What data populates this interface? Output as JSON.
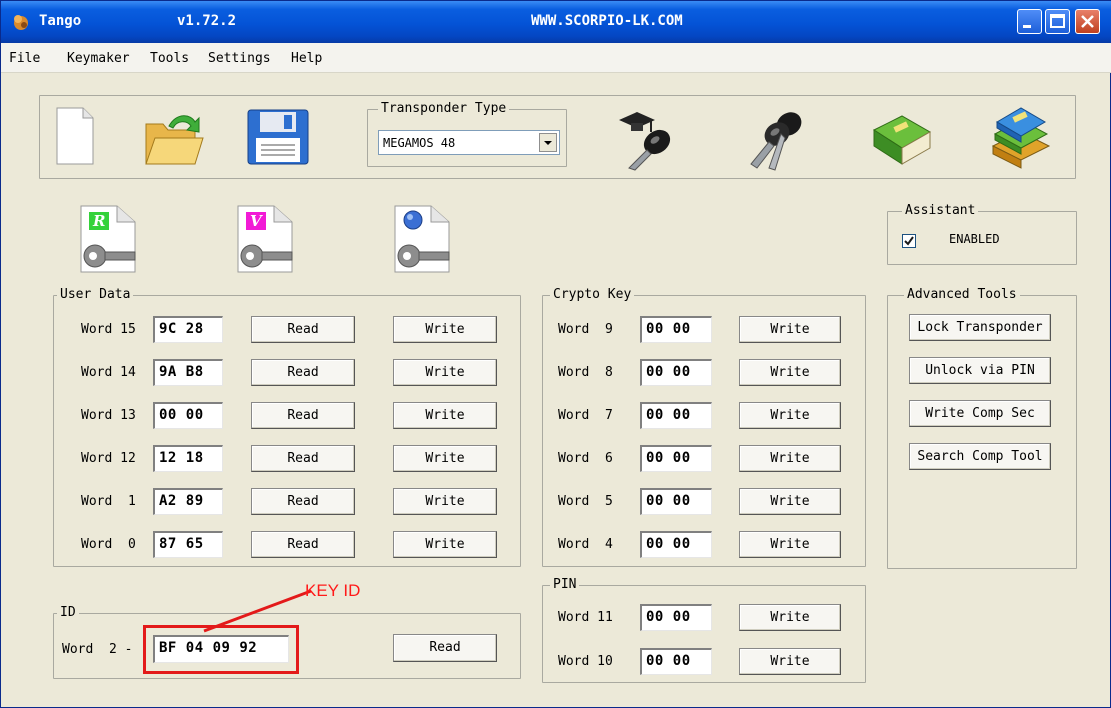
{
  "window": {
    "title": "Tango",
    "version": "v1.72.2",
    "site": "WWW.SCORPIO-LK.COM"
  },
  "menu": [
    "File",
    "Keymaker",
    "Tools",
    "Settings",
    "Help"
  ],
  "toolbar": {
    "transponder_label": "Transponder Type",
    "transponder_value": "MEGAMOS 48"
  },
  "assistant": {
    "label": "Assistant",
    "checkbox_label": "ENABLED",
    "checked": true
  },
  "user_data": {
    "label": "User Data",
    "read_label": "Read",
    "write_label": "Write",
    "rows": [
      {
        "word": "Word 15",
        "value": "9C 28"
      },
      {
        "word": "Word 14",
        "value": "9A B8"
      },
      {
        "word": "Word 13",
        "value": "00 00"
      },
      {
        "word": "Word 12",
        "value": "12 18"
      },
      {
        "word": "Word  1",
        "value": "A2 89"
      },
      {
        "word": "Word  0",
        "value": "87 65"
      }
    ]
  },
  "crypto_key": {
    "label": "Crypto Key",
    "write_label": "Write",
    "rows": [
      {
        "word": "Word  9",
        "value": "00 00"
      },
      {
        "word": "Word  8",
        "value": "00 00"
      },
      {
        "word": "Word  7",
        "value": "00 00"
      },
      {
        "word": "Word  6",
        "value": "00 00"
      },
      {
        "word": "Word  5",
        "value": "00 00"
      },
      {
        "word": "Word  4",
        "value": "00 00"
      }
    ]
  },
  "pin": {
    "label": "PIN",
    "write_label": "Write",
    "rows": [
      {
        "word": "Word 11",
        "value": "00 00"
      },
      {
        "word": "Word 10",
        "value": "00 00"
      }
    ]
  },
  "id": {
    "label": "ID",
    "word": "Word  2 -",
    "value": "BF 04 09 92",
    "read_label": "Read"
  },
  "advanced_tools": {
    "label": "Advanced Tools",
    "buttons": [
      "Lock Transponder",
      "Unlock via PIN",
      "Write Comp Sec",
      "Search Comp Tool"
    ]
  },
  "annotation": {
    "text": "KEY ID",
    "color": "#e31a1a"
  },
  "colors": {
    "titlebar": "#0453d6",
    "face": "#ece9d8"
  }
}
